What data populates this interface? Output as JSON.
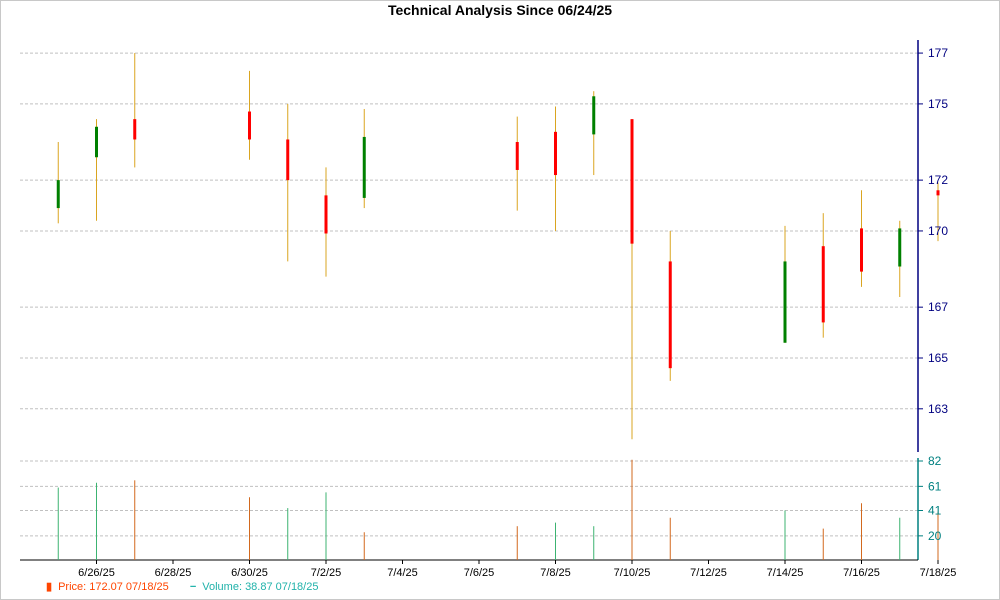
{
  "chart_data": [
    {
      "type": "candlestick",
      "title": "Technical Analysis Since 06/24/25",
      "x_tick_labels": [
        "6/26/25",
        "6/28/25",
        "6/30/25",
        "7/2/25",
        "7/4/25",
        "7/6/25",
        "7/8/25",
        "7/10/25",
        "7/12/25",
        "7/14/25",
        "7/16/25",
        "7/18/25"
      ],
      "x_range": [
        "6/24/25",
        "7/18/25"
      ],
      "y_ticks": [
        163,
        165,
        167,
        170,
        172,
        175,
        177
      ],
      "ylim": [
        161.3,
        177.2
      ],
      "y_axis_side": "right",
      "grid": true,
      "up_color": "#008000",
      "down_color": "#ff0000",
      "wick_color": "#daa520",
      "series": [
        {
          "name": "Price",
          "candles": [
            {
              "date": "6/25/25",
              "open": 170.9,
              "high": 173.5,
              "low": 170.3,
              "close": 172.0
            },
            {
              "date": "6/26/25",
              "open": 172.9,
              "high": 174.4,
              "low": 170.4,
              "close": 174.1
            },
            {
              "date": "6/27/25",
              "open": 174.4,
              "high": 177.0,
              "low": 172.5,
              "close": 173.6
            },
            {
              "date": "6/30/25",
              "open": 174.7,
              "high": 176.3,
              "low": 172.8,
              "close": 173.6
            },
            {
              "date": "7/1/25",
              "open": 173.6,
              "high": 175.0,
              "low": 168.8,
              "close": 172.0
            },
            {
              "date": "7/2/25",
              "open": 171.4,
              "high": 172.5,
              "low": 168.2,
              "close": 169.9
            },
            {
              "date": "7/3/25",
              "open": 171.3,
              "high": 174.8,
              "low": 170.9,
              "close": 173.7
            },
            {
              "date": "7/7/25",
              "open": 173.5,
              "high": 174.5,
              "low": 170.8,
              "close": 172.4
            },
            {
              "date": "7/8/25",
              "open": 173.9,
              "high": 174.9,
              "low": 170.0,
              "close": 172.2
            },
            {
              "date": "7/9/25",
              "open": 173.8,
              "high": 175.5,
              "low": 172.2,
              "close": 175.3
            },
            {
              "date": "7/10/25",
              "open": 174.4,
              "high": 174.4,
              "low": 161.8,
              "close": 169.5
            },
            {
              "date": "7/11/25",
              "open": 168.8,
              "high": 170.0,
              "low": 164.1,
              "close": 164.6
            },
            {
              "date": "7/14/25",
              "open": 165.6,
              "high": 170.2,
              "low": 165.6,
              "close": 168.8
            },
            {
              "date": "7/15/25",
              "open": 169.4,
              "high": 170.7,
              "low": 165.8,
              "close": 166.4
            },
            {
              "date": "7/16/25",
              "open": 170.1,
              "high": 171.6,
              "low": 167.8,
              "close": 168.4
            },
            {
              "date": "7/17/25",
              "open": 168.6,
              "high": 170.4,
              "low": 167.4,
              "close": 170.1
            },
            {
              "date": "7/18/25",
              "open": 171.6,
              "high": 171.9,
              "low": 169.6,
              "close": 171.4
            }
          ]
        }
      ],
      "legend_price_label": "Price: 172.07  07/18/25",
      "legend_position": "bottom-left"
    },
    {
      "type": "bar",
      "title": "",
      "x_tick_labels": [
        "6/26/25",
        "6/28/25",
        "6/30/25",
        "7/2/25",
        "7/4/25",
        "7/6/25",
        "7/8/25",
        "7/10/25",
        "7/12/25",
        "7/14/25",
        "7/16/25",
        "7/18/25"
      ],
      "y_ticks": [
        20,
        41,
        61,
        82
      ],
      "ylim": [
        0,
        82
      ],
      "y_axis_side": "right",
      "grid": true,
      "up_color": "#3cb371",
      "down_color": "#d2691e",
      "series": [
        {
          "name": "Volume",
          "points": [
            {
              "date": "6/25/25",
              "value": 60,
              "dir": "up"
            },
            {
              "date": "6/26/25",
              "value": 64,
              "dir": "up"
            },
            {
              "date": "6/27/25",
              "value": 66,
              "dir": "down"
            },
            {
              "date": "6/30/25",
              "value": 52,
              "dir": "down"
            },
            {
              "date": "7/1/25",
              "value": 43,
              "dir": "up"
            },
            {
              "date": "7/2/25",
              "value": 56,
              "dir": "up"
            },
            {
              "date": "7/3/25",
              "value": 23,
              "dir": "down"
            },
            {
              "date": "7/7/25",
              "value": 28,
              "dir": "down"
            },
            {
              "date": "7/8/25",
              "value": 31,
              "dir": "up"
            },
            {
              "date": "7/9/25",
              "value": 28,
              "dir": "up"
            },
            {
              "date": "7/10/25",
              "value": 83,
              "dir": "down"
            },
            {
              "date": "7/11/25",
              "value": 35,
              "dir": "down"
            },
            {
              "date": "7/14/25",
              "value": 41,
              "dir": "up"
            },
            {
              "date": "7/15/25",
              "value": 26,
              "dir": "down"
            },
            {
              "date": "7/16/25",
              "value": 47,
              "dir": "down"
            },
            {
              "date": "7/17/25",
              "value": 35,
              "dir": "up"
            },
            {
              "date": "7/18/25",
              "value": 40,
              "dir": "down"
            }
          ]
        }
      ],
      "legend_volume_label": "Volume: 38.87  07/18/25"
    }
  ],
  "legend": {
    "price_marker": "▮",
    "volume_marker": "−"
  }
}
